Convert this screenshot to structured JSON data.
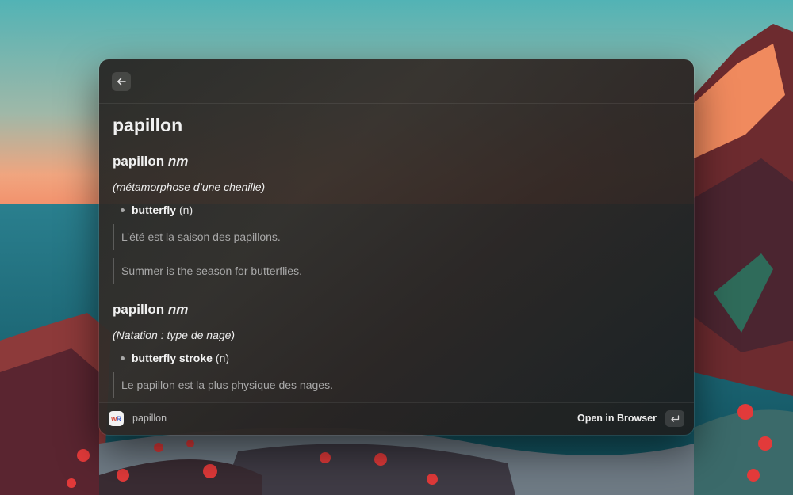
{
  "toolbar": {
    "back_icon": "arrow-left-icon"
  },
  "result": {
    "word": "papillon",
    "entries": [
      {
        "headword": "papillon",
        "pos": "nm",
        "context": "(métamorphose d’une chenille)",
        "translation": {
          "term": "butterfly",
          "pos": "(n)"
        },
        "examples": [
          "L’été est la saison des papillons.",
          "Summer is the season for butterflies."
        ]
      },
      {
        "headword": "papillon",
        "pos": "nm",
        "context": "(Natation : type de nage)",
        "translation": {
          "term": "butterfly stroke",
          "pos": "(n)"
        },
        "examples": [
          "Le papillon est la plus physique des nages."
        ]
      }
    ]
  },
  "footer": {
    "app_icon": "wordreference-icon",
    "app_icon_text_w": "w",
    "app_icon_text_r": "R",
    "title": "papillon",
    "action_label": "Open in Browser",
    "action_key_icon": "return-key-icon"
  },
  "colors": {
    "window_bg": "#2b2a28",
    "text_primary": "#f1f1f1",
    "text_muted": "#a9a9a9"
  }
}
